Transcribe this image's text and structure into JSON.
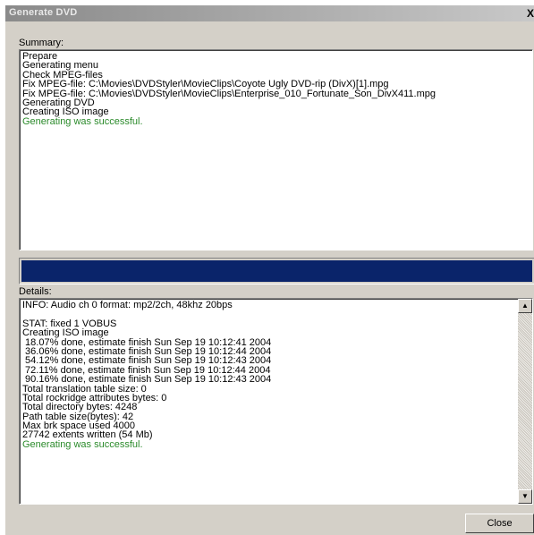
{
  "window": {
    "title": "Generate DVD",
    "close_glyph": "X"
  },
  "summary": {
    "label": "Summary:",
    "lines": [
      {
        "text": "Prepare",
        "status": "normal"
      },
      {
        "text": "Generating menu",
        "status": "normal"
      },
      {
        "text": "Check MPEG-files",
        "status": "normal"
      },
      {
        "text": "Fix MPEG-file: C:\\Movies\\DVDStyler\\MovieClips\\Coyote Ugly DVD-rip (DivX)[1].mpg",
        "status": "normal"
      },
      {
        "text": "Fix MPEG-file: C:\\Movies\\DVDStyler\\MovieClips\\Enterprise_010_Fortunate_Son_DivX411.mpg",
        "status": "normal"
      },
      {
        "text": "Generating DVD",
        "status": "normal"
      },
      {
        "text": "Creating ISO image",
        "status": "normal"
      },
      {
        "text": "Generating was successful.",
        "status": "success"
      }
    ]
  },
  "progress": {
    "fraction": 1.0,
    "fill_color": "#0a246a"
  },
  "details": {
    "label": "Details:",
    "lines": [
      {
        "text": "INFO: Audio ch 0 format: mp2/2ch, 48khz 20bps",
        "status": "normal"
      },
      {
        "text": "",
        "status": "normal"
      },
      {
        "text": "STAT: fixed 1 VOBUS",
        "status": "normal"
      },
      {
        "text": "Creating ISO image",
        "status": "normal"
      },
      {
        "text": " 18.07% done, estimate finish Sun Sep 19 10:12:41 2004",
        "status": "normal"
      },
      {
        "text": " 36.06% done, estimate finish Sun Sep 19 10:12:44 2004",
        "status": "normal"
      },
      {
        "text": " 54.12% done, estimate finish Sun Sep 19 10:12:43 2004",
        "status": "normal"
      },
      {
        "text": " 72.11% done, estimate finish Sun Sep 19 10:12:44 2004",
        "status": "normal"
      },
      {
        "text": " 90.16% done, estimate finish Sun Sep 19 10:12:43 2004",
        "status": "normal"
      },
      {
        "text": "Total translation table size: 0",
        "status": "normal"
      },
      {
        "text": "Total rockridge attributes bytes: 0",
        "status": "normal"
      },
      {
        "text": "Total directory bytes: 4248",
        "status": "normal"
      },
      {
        "text": "Path table size(bytes): 42",
        "status": "normal"
      },
      {
        "text": "Max brk space used 4000",
        "status": "normal"
      },
      {
        "text": "27742 extents written (54 Mb)",
        "status": "normal"
      },
      {
        "text": "Generating was successful.",
        "status": "success"
      }
    ],
    "scroll_up_icon": "scroll-up-arrow-icon",
    "scroll_down_icon": "scroll-down-arrow-icon"
  },
  "buttons": {
    "close_label": "Close"
  },
  "colors": {
    "success_text": "#2a8a2a",
    "dialog_face": "#d4d0c8"
  }
}
